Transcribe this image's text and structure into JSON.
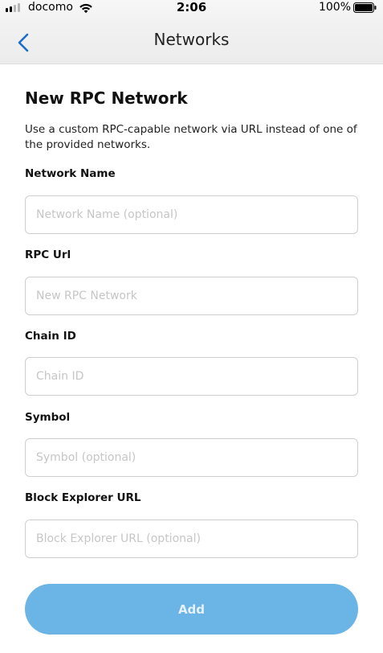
{
  "status_bar": {
    "carrier": "docomo",
    "time": "2:06",
    "battery": "100%"
  },
  "nav": {
    "title": "Networks",
    "back_icon": "chevron-left-icon",
    "accent_color": "#1a6ec7"
  },
  "form": {
    "heading": "New RPC Network",
    "description": "Use a custom RPC-capable network via URL instead of one of the provided networks.",
    "fields": [
      {
        "label": "Network Name",
        "placeholder": "Network Name (optional)",
        "value": ""
      },
      {
        "label": "RPC Url",
        "placeholder": "New RPC Network",
        "value": ""
      },
      {
        "label": "Chain ID",
        "placeholder": "Chain ID",
        "value": ""
      },
      {
        "label": "Symbol",
        "placeholder": "Symbol (optional)",
        "value": ""
      },
      {
        "label": "Block Explorer URL",
        "placeholder": "Block Explorer URL (optional)",
        "value": ""
      }
    ],
    "submit_label": "Add",
    "submit_color": "#6bb4e6"
  }
}
